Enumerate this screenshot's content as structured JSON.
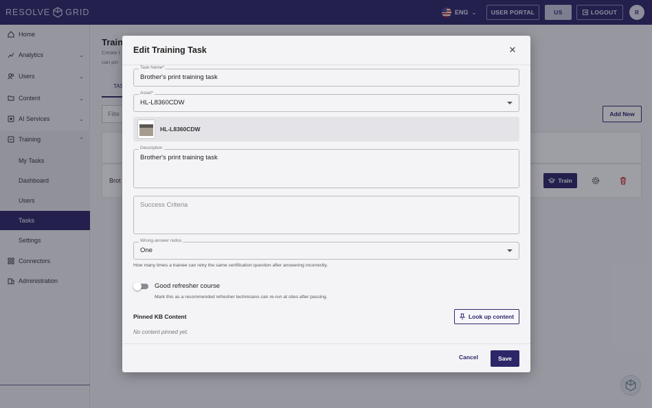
{
  "topbar": {
    "brand": "RESOLVE",
    "brand_suffix": "GRID",
    "language": "ENG",
    "user_portal": "USER PORTAL",
    "region": "US",
    "logout": "LOGOUT",
    "avatar_initial": "R"
  },
  "sidebar": {
    "items": [
      {
        "label": "Home",
        "icon": "home-icon"
      },
      {
        "label": "Analytics",
        "icon": "analytics-icon"
      },
      {
        "label": "Users",
        "icon": "users-icon"
      },
      {
        "label": "Content",
        "icon": "folder-icon"
      },
      {
        "label": "AI Services",
        "icon": "ai-icon"
      },
      {
        "label": "Training",
        "icon": "training-icon"
      }
    ],
    "training_sub": [
      "My Tasks",
      "Dashboard",
      "Users",
      "Tasks",
      "Settings"
    ],
    "bottom_items": [
      {
        "label": "Connectors",
        "icon": "grid-icon"
      },
      {
        "label": "Administration",
        "icon": "building-icon"
      }
    ]
  },
  "page": {
    "title": "Train",
    "subtitle": "Create t can pin",
    "tab": "TAS",
    "filter": "Filte",
    "add_new": "Add New",
    "row_name": "Brot",
    "train_button": "Train"
  },
  "modal": {
    "title": "Edit Training Task",
    "task_name_label": "Task Name*",
    "task_name_value": "Brother's print training task",
    "asset_label": "Asset*",
    "asset_value": "HL-L8360CDW",
    "asset_card_name": "HL-L8360CDW",
    "description_label": "Description",
    "description_value": "Brother's print training task",
    "success_placeholder": "Success Criteria",
    "redos_label": "Wrong-answer redos",
    "redos_value": "One",
    "redos_help": "How many times a trainee can retry the same certification question after answering incorrectly.",
    "refresher_label": "Good refresher course",
    "refresher_help": "Mark this as a recommended refresher technicians can re-run at sites after passing.",
    "refresher_on": false,
    "pinned_title": "Pinned KB Content",
    "lookup_button": "Look up content",
    "no_pinned": "No content pinned yet.",
    "cancel": "Cancel",
    "save": "Save"
  },
  "colors": {
    "brand_navy": "#2c2769",
    "danger_red": "#d0312d"
  }
}
